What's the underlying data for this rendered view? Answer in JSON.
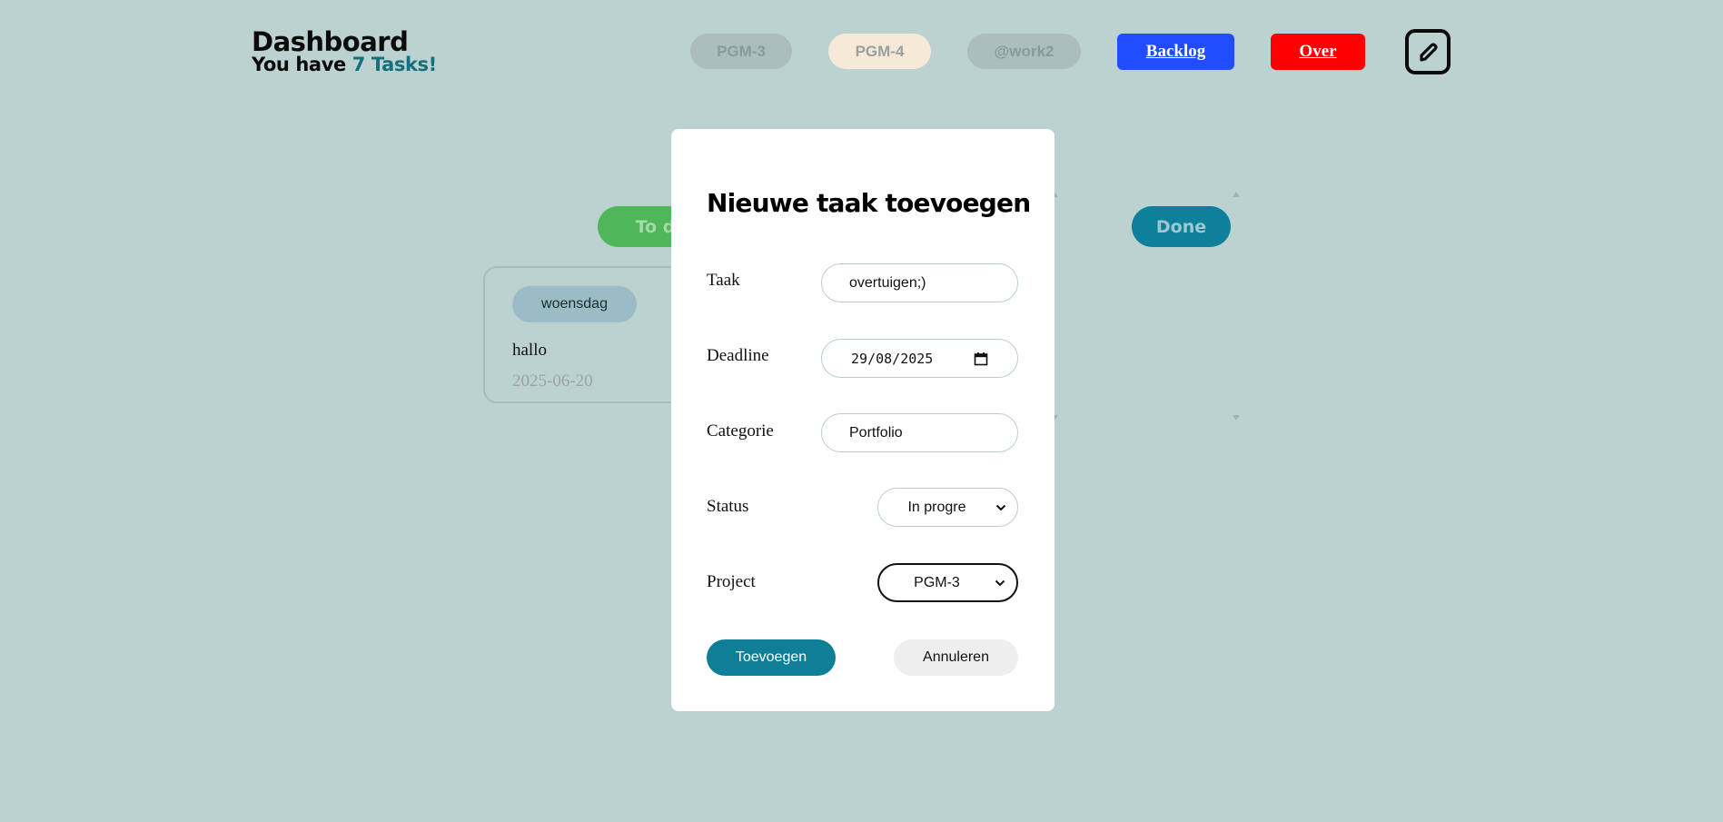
{
  "header": {
    "title": "Dashboard",
    "subtitle_prefix": "You have",
    "subtitle_count": "7 Tasks!",
    "projects": [
      "PGM-3",
      "PGM-4",
      "@work2"
    ],
    "nav": {
      "backlog": "Backlog",
      "over": "Over"
    },
    "edit_icon": "pencil-icon"
  },
  "board": {
    "columns": [
      "To do",
      "Done"
    ],
    "cards": [
      {
        "category": "woensdag",
        "title": "hallo",
        "date": "2025-06-20"
      }
    ]
  },
  "modal": {
    "title": "Nieuwe taak toevoegen",
    "fields": {
      "taak": {
        "label": "Taak",
        "value": "overtuigen;)"
      },
      "deadline": {
        "label": "Deadline",
        "day": "29",
        "month": "08",
        "year": "2025"
      },
      "categorie": {
        "label": "Categorie",
        "value": "Portfolio"
      },
      "status": {
        "label": "Status",
        "value": "In progre"
      },
      "project": {
        "label": "Project",
        "value": "PGM-3"
      }
    },
    "buttons": {
      "submit": "Toevoegen",
      "cancel": "Annuleren"
    }
  },
  "colors": {
    "background": "#bcd2d1",
    "accent": "#0e7f97",
    "backlog": "#1f4dff",
    "over": "#ff0000",
    "todo": "#4fb65a"
  }
}
